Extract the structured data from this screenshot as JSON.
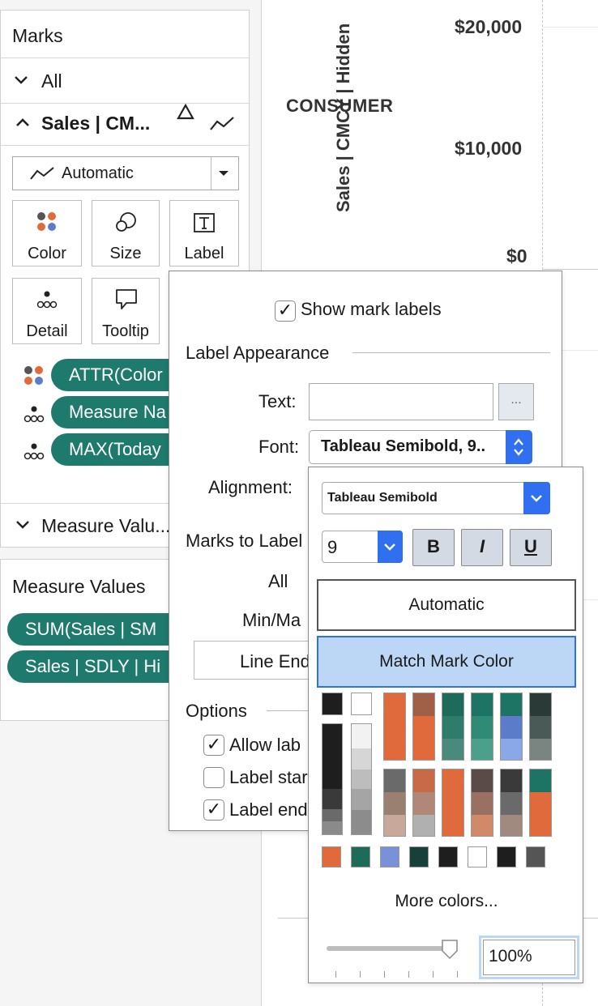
{
  "canvas": {
    "category_label": "CONSUMER",
    "axis_title": "Sales | CMCY | Hidden",
    "axis_ticks": [
      "$20,000",
      "$10,000",
      "$0"
    ]
  },
  "marks": {
    "title": "Marks",
    "all_label": "All",
    "card_title": "Sales | CM...",
    "mark_type": "Automatic",
    "cards": {
      "color": "Color",
      "size": "Size",
      "label": "Label",
      "detail": "Detail",
      "tooltip": "Tooltip"
    },
    "pills": [
      "ATTR(Color",
      "Measure Na",
      "MAX(Today"
    ],
    "measure_values_section": "Measure Valu..."
  },
  "measure_values": {
    "title": "Measure Values",
    "pills": [
      "SUM(Sales | SM",
      "Sales | SDLY | Hi"
    ]
  },
  "label_popup": {
    "show_mark_labels": "Show mark labels",
    "show_mark_labels_checked": true,
    "label_appearance": "Label Appearance",
    "text_label": "Text:",
    "text_button": "...",
    "font_label": "Font:",
    "font_value": "Tableau Semibold, 9..",
    "alignment_label": "Alignment:",
    "marks_to_label": "Marks to Label",
    "all_option": "All",
    "minmax_option": "Min/Ma",
    "line_ends_button": "Line End",
    "options_title": "Options",
    "options": [
      {
        "label": "Allow lab",
        "checked": true
      },
      {
        "label": "Label star",
        "checked": false
      },
      {
        "label": "Label end",
        "checked": true
      }
    ]
  },
  "font_popup": {
    "font_family": "Tableau Semibold",
    "font_size": "9",
    "bold": "B",
    "italic": "I",
    "underline": "U",
    "automatic": "Automatic",
    "match_mark_color": "Match Mark Color",
    "more_colors": "More colors...",
    "opacity": "100%",
    "opacity_value": 1.0
  },
  "colors": {
    "teal_pill": "#1f7a6e",
    "orange": "#e06a3c",
    "teal": "#1d7464",
    "blue": "#5b7cc9",
    "selected": "#bcd6f5",
    "accent_blue": "#2f6ff0"
  }
}
